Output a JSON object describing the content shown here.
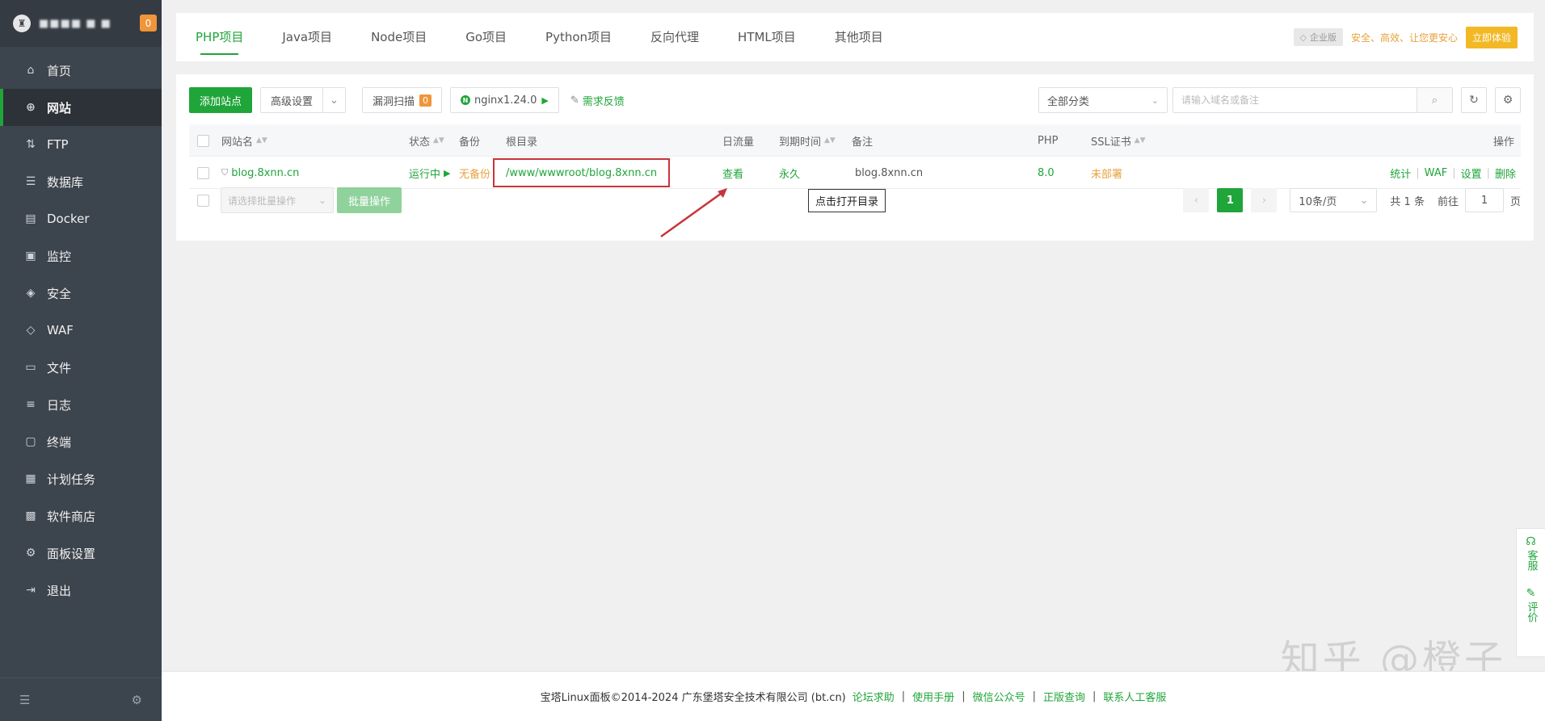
{
  "sidebar": {
    "user_name": "■■■■ ■ ■",
    "notify_count": "0",
    "items": [
      {
        "label": "首页",
        "icon": "home-icon",
        "glyph": "⌂"
      },
      {
        "label": "网站",
        "icon": "globe-icon",
        "glyph": "⊕"
      },
      {
        "label": "FTP",
        "icon": "ftp-icon",
        "glyph": "⇅"
      },
      {
        "label": "数据库",
        "icon": "database-icon",
        "glyph": "☰"
      },
      {
        "label": "Docker",
        "icon": "docker-icon",
        "glyph": "▤"
      },
      {
        "label": "监控",
        "icon": "monitor-icon",
        "glyph": "▣"
      },
      {
        "label": "安全",
        "icon": "shield-icon",
        "glyph": "◈"
      },
      {
        "label": "WAF",
        "icon": "waf-icon",
        "glyph": "◇"
      },
      {
        "label": "文件",
        "icon": "folder-icon",
        "glyph": "▭"
      },
      {
        "label": "日志",
        "icon": "log-icon",
        "glyph": "≡"
      },
      {
        "label": "终端",
        "icon": "terminal-icon",
        "glyph": "▢"
      },
      {
        "label": "计划任务",
        "icon": "calendar-icon",
        "glyph": "▦"
      },
      {
        "label": "软件商店",
        "icon": "store-icon",
        "glyph": "▩"
      },
      {
        "label": "面板设置",
        "icon": "settings-icon",
        "glyph": "⚙"
      },
      {
        "label": "退出",
        "icon": "logout-icon",
        "glyph": "⇥"
      }
    ],
    "active_index": 1
  },
  "tabs": [
    "PHP项目",
    "Java项目",
    "Node项目",
    "Go项目",
    "Python项目",
    "反向代理",
    "HTML项目",
    "其他项目"
  ],
  "enterprise": {
    "badge": "企业版",
    "slogan": "安全、高效、让您更安心",
    "trial_button": "立即体验"
  },
  "toolbar": {
    "add_site": "添加站点",
    "advanced": "高级设置",
    "vuln_scan": "漏洞扫描",
    "vuln_count": "0",
    "nginx": "nginx1.24.0",
    "feedback": "需求反馈",
    "category_select": "全部分类",
    "search_placeholder": "请输入域名或备注"
  },
  "table": {
    "headers": {
      "name": "网站名",
      "status": "状态",
      "backup": "备份",
      "root": "根目录",
      "traffic": "日流量",
      "expire": "到期时间",
      "remark": "备注",
      "php": "PHP",
      "ssl": "SSL证书",
      "ops": "操作"
    },
    "rows": [
      {
        "name": "blog.8xnn.cn",
        "status": "运行中",
        "backup": "无备份",
        "root": "/www/wwwroot/blog.8xnn.cn",
        "traffic": "查看",
        "expire": "永久",
        "remark": "blog.8xnn.cn",
        "php": "8.0",
        "ssl": "未部署",
        "ops": [
          "统计",
          "WAF",
          "设置",
          "删除"
        ]
      }
    ]
  },
  "tooltip": "点击打开目录",
  "batch": {
    "select_placeholder": "请选择批量操作",
    "button": "批量操作"
  },
  "pager": {
    "current": "1",
    "page_size": "10条/页",
    "total": "共 1 条",
    "goto_label": "前往",
    "goto_value": "1",
    "page_unit": "页"
  },
  "footer": {
    "copyright": "宝塔Linux面板©2014-2024 广东堡塔安全技术有限公司 (bt.cn)",
    "links": [
      "论坛求助",
      "使用手册",
      "微信公众号",
      "正版查询",
      "联系人工客服"
    ]
  },
  "float": {
    "service": "客服",
    "review": "评价"
  },
  "watermark": "知乎 @橙子",
  "colors": {
    "accent": "#20a53a",
    "sidebar": "#3c444d",
    "warning": "#e6a23c",
    "highlight": "#c8343a"
  }
}
